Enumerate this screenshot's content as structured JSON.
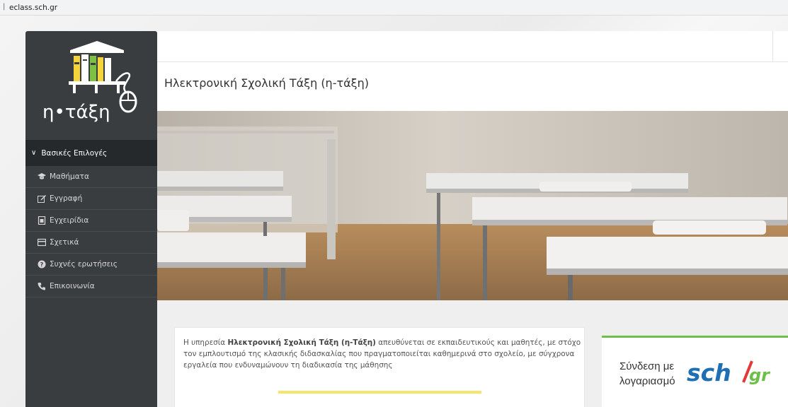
{
  "browser": {
    "url": "eclass.sch.gr"
  },
  "sidebar": {
    "logo_text": "η•τάξη",
    "section_title": "Βασικές Επιλογές",
    "items": [
      {
        "label": "Μαθήματα",
        "icon": "graduation-cap-icon"
      },
      {
        "label": "Εγγραφή",
        "icon": "edit-icon"
      },
      {
        "label": "Εγχειρίδια",
        "icon": "document-icon"
      },
      {
        "label": "Σχετικά",
        "icon": "card-icon"
      },
      {
        "label": "Συχνές ερωτήσεις",
        "icon": "question-circle-icon"
      },
      {
        "label": "Επικοινωνία",
        "icon": "phone-icon"
      }
    ]
  },
  "page": {
    "title": "Ηλεκτρονική Σχολική Τάξη (η-τάξη)"
  },
  "intro": {
    "text_before": "Η υπηρεσία ",
    "text_bold": "Ηλεκτρονική Σχολική Τάξη (η-Τάξη)",
    "text_after": " απευθύνεται σε εκπαιδευτικούς και μαθητές, με στόχο τον εμπλουτισμό της κλασικής διδασκαλίας που πραγματοποιείται καθημερινά στο σχολείο, με σύγχρονα εργαλεία που ενδυναμώνουν τη διαδικασία της μάθησης"
  },
  "login": {
    "line1": "Σύνδεση με",
    "line2": "λογαριασμό",
    "brand": "sch.gr"
  },
  "colors": {
    "sidebar": "#3a3d40",
    "accent_green": "#6cc04a",
    "accent_yellow": "#f7e46a",
    "brand_blue": "#1f6fb5"
  }
}
